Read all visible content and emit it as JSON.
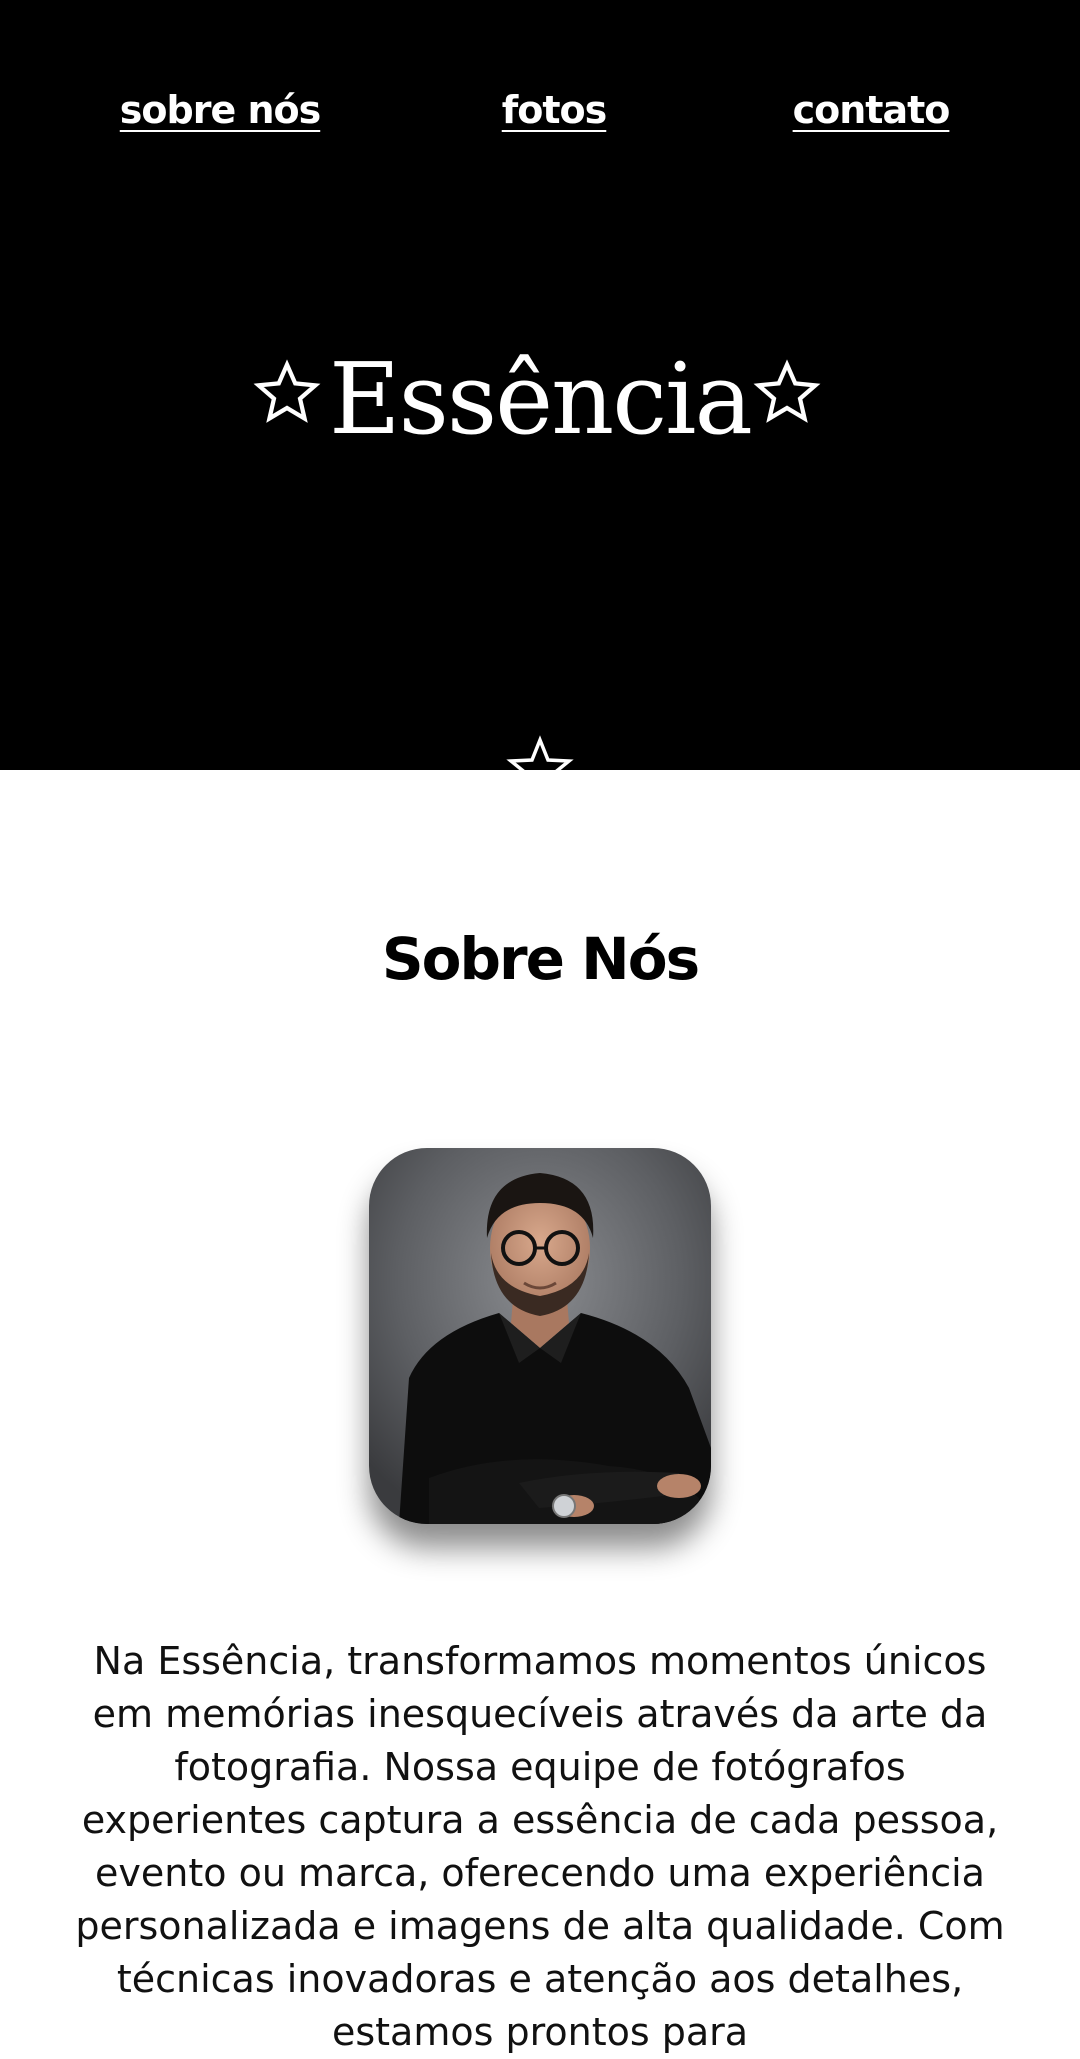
{
  "nav": {
    "items": [
      "sobre nós",
      "fotos",
      "contato"
    ]
  },
  "brand": {
    "title": "Essência"
  },
  "about": {
    "title": "Sobre Nós",
    "text": "Na Essência, transformamos momentos únicos em memórias inesquecíveis através da arte da fotografia. Nossa equipe de fotógrafos experientes captura a essência de cada pessoa, evento ou marca, oferecendo uma experiência personalizada e imagens de alta qualidade. Com técnicas inovadoras e atenção aos detalhes, estamos prontos para"
  },
  "colors": {
    "hero_bg": "#000000",
    "page_bg": "#ffffff",
    "text": "#111111"
  },
  "icons": [
    "star-outline-icon"
  ]
}
